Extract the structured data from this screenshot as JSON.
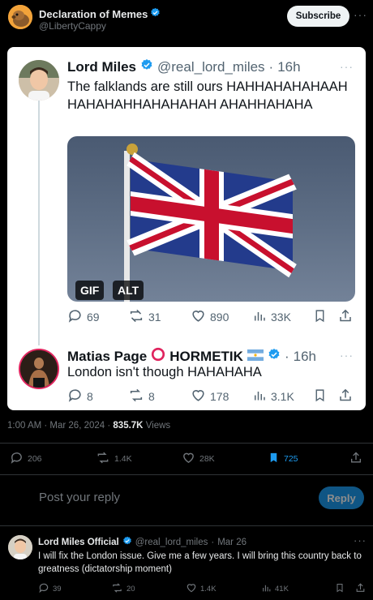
{
  "post": {
    "author_name": "Declaration of Memes",
    "author_handle": "@LibertyCappy",
    "subscribe_label": "Subscribe",
    "more_label": "···"
  },
  "embedded": {
    "tweet1": {
      "name": "Lord Miles",
      "handle": "@real_lord_miles",
      "separator": "·",
      "time": "16h",
      "text": "The falklands are still ours HAHHAHAHAHAAHHAHAHAHHAHAHAHAH AHAHHAHAHA",
      "gif_label": "GIF",
      "alt_label": "ALT",
      "replies": "69",
      "reposts": "31",
      "likes": "890",
      "views": "33K"
    },
    "tweet2": {
      "name": "Matias Page",
      "name_suffix": "HORMETIK",
      "separator": "·",
      "time": "16h",
      "text": "London isn't though HAHAHAHA",
      "replies": "8",
      "reposts": "8",
      "likes": "178",
      "views": "3.1K"
    },
    "more_label": "···"
  },
  "meta": {
    "time_date": "1:00 AM · Mar 26, 2024 · ",
    "views_count": "835.7K",
    "views_label": " Views"
  },
  "stats": {
    "replies": "206",
    "reposts": "1.4K",
    "likes": "28K",
    "bookmarks": "725"
  },
  "reply_box": {
    "placeholder": "Post your reply",
    "button_label": "Reply"
  },
  "comment": {
    "name": "Lord Miles Official",
    "handle": "@real_lord_miles",
    "separator": "·",
    "date": "Mar 26",
    "text": "I will fix the London issue. Give me a few years. I will bring this country back to greatness (dictatorship moment)",
    "replies": "39",
    "reposts": "20",
    "likes": "1.4K",
    "views": "41K",
    "more_label": "···"
  },
  "colors": {
    "background": "#000000",
    "accent_blue": "#1d9bf0",
    "card_background": "#ffffff",
    "muted": "#71767b"
  },
  "icons": [
    "avatar",
    "verified-badge-icon",
    "more-icon",
    "reply-icon",
    "repost-icon",
    "like-icon",
    "views-icon",
    "bookmark-icon",
    "share-icon",
    "flag-argentina-icon",
    "red-circle-icon"
  ]
}
